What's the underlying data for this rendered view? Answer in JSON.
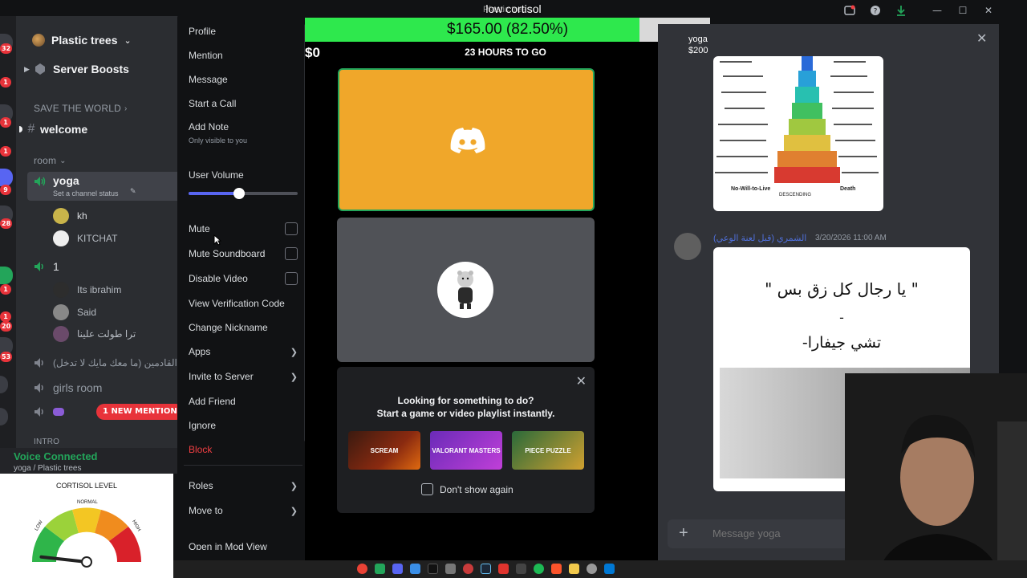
{
  "overlay": {
    "title": "low cortisol",
    "subtitle": "Plastic trees"
  },
  "server": {
    "name": "Plastic trees"
  },
  "sidebar": {
    "boosts_label": "Server Boosts",
    "category_world": "SAVE THE WORLD",
    "welcome": "welcome",
    "category_room": "room",
    "voice_yoga": "yoga",
    "channel_status_hint": "Set a channel status",
    "yoga_users": [
      "kh",
      "KITCHAT"
    ],
    "voice_1": "1",
    "voice_1_users": [
      "Its ibrahim",
      "Said",
      "ترا طولت علينا"
    ],
    "voice_arabic": "ب القادمين (ما معك مايك لا تدخل)",
    "voice_girls": "girls room",
    "category_intro": "INTRO",
    "new_mention": "1 NEW MENTION",
    "rail_badges": [
      "32",
      "1",
      "1",
      "1",
      "9",
      "28",
      "1",
      "1",
      "20",
      "53"
    ]
  },
  "voice_status": {
    "title": "Voice Connected",
    "subtitle": "yoga / Plastic trees"
  },
  "gauge": {
    "title": "CORTISOL LEVEL",
    "low": "LOW",
    "normal": "NORMAL",
    "high": "HIGH",
    "level_fraction": 0.08
  },
  "context_menu": {
    "profile": "Profile",
    "mention": "Mention",
    "message": "Message",
    "start_call": "Start a Call",
    "add_note": "Add Note",
    "add_note_hint": "Only visible to you",
    "user_volume": "User Volume",
    "volume_fraction": 0.46,
    "mute": "Mute",
    "mute_soundboard": "Mute Soundboard",
    "disable_video": "Disable Video",
    "view_verification": "View Verification Code",
    "change_nickname": "Change Nickname",
    "apps": "Apps",
    "invite_to_server": "Invite to Server",
    "add_friend": "Add Friend",
    "ignore": "Ignore",
    "block": "Block",
    "roles": "Roles",
    "move_to": "Move to",
    "open_mod_view": "Open in Mod View"
  },
  "goal": {
    "progress_text": "$165.00 (82.50%)",
    "progress_fraction": 0.825,
    "left_amount": "$0",
    "right_amount": "$200",
    "time_left": "23 HOURS TO GO"
  },
  "activity": {
    "line1": "Looking for something to do?",
    "line2": "Start a game or video playlist instantly.",
    "thumbs": [
      "SCREAM",
      "VALORANT MASTERS",
      "PIECE PUZZLE"
    ],
    "dont_show": "Don't show again"
  },
  "thread": {
    "header_name": "yoga",
    "chart_bottom_left": "No-Will-to-Live",
    "chart_bottom_mid": "DESCENDING",
    "chart_bottom_right": "Death",
    "author": "الشمري (قبل لعنة الوعي)",
    "timestamp": "3/20/2026 11:00 AM",
    "quote_line1": "\" يا رجال كل زق بس \"",
    "quote_dash": "-",
    "quote_line2": "-تشي جيفارا",
    "composer_placeholder": "Message yoga"
  },
  "colors": {
    "accent": "#5865f2",
    "online": "#23a55a",
    "danger": "#f23f43",
    "progress": "#2ee84d",
    "tile": "#f0a72a"
  }
}
